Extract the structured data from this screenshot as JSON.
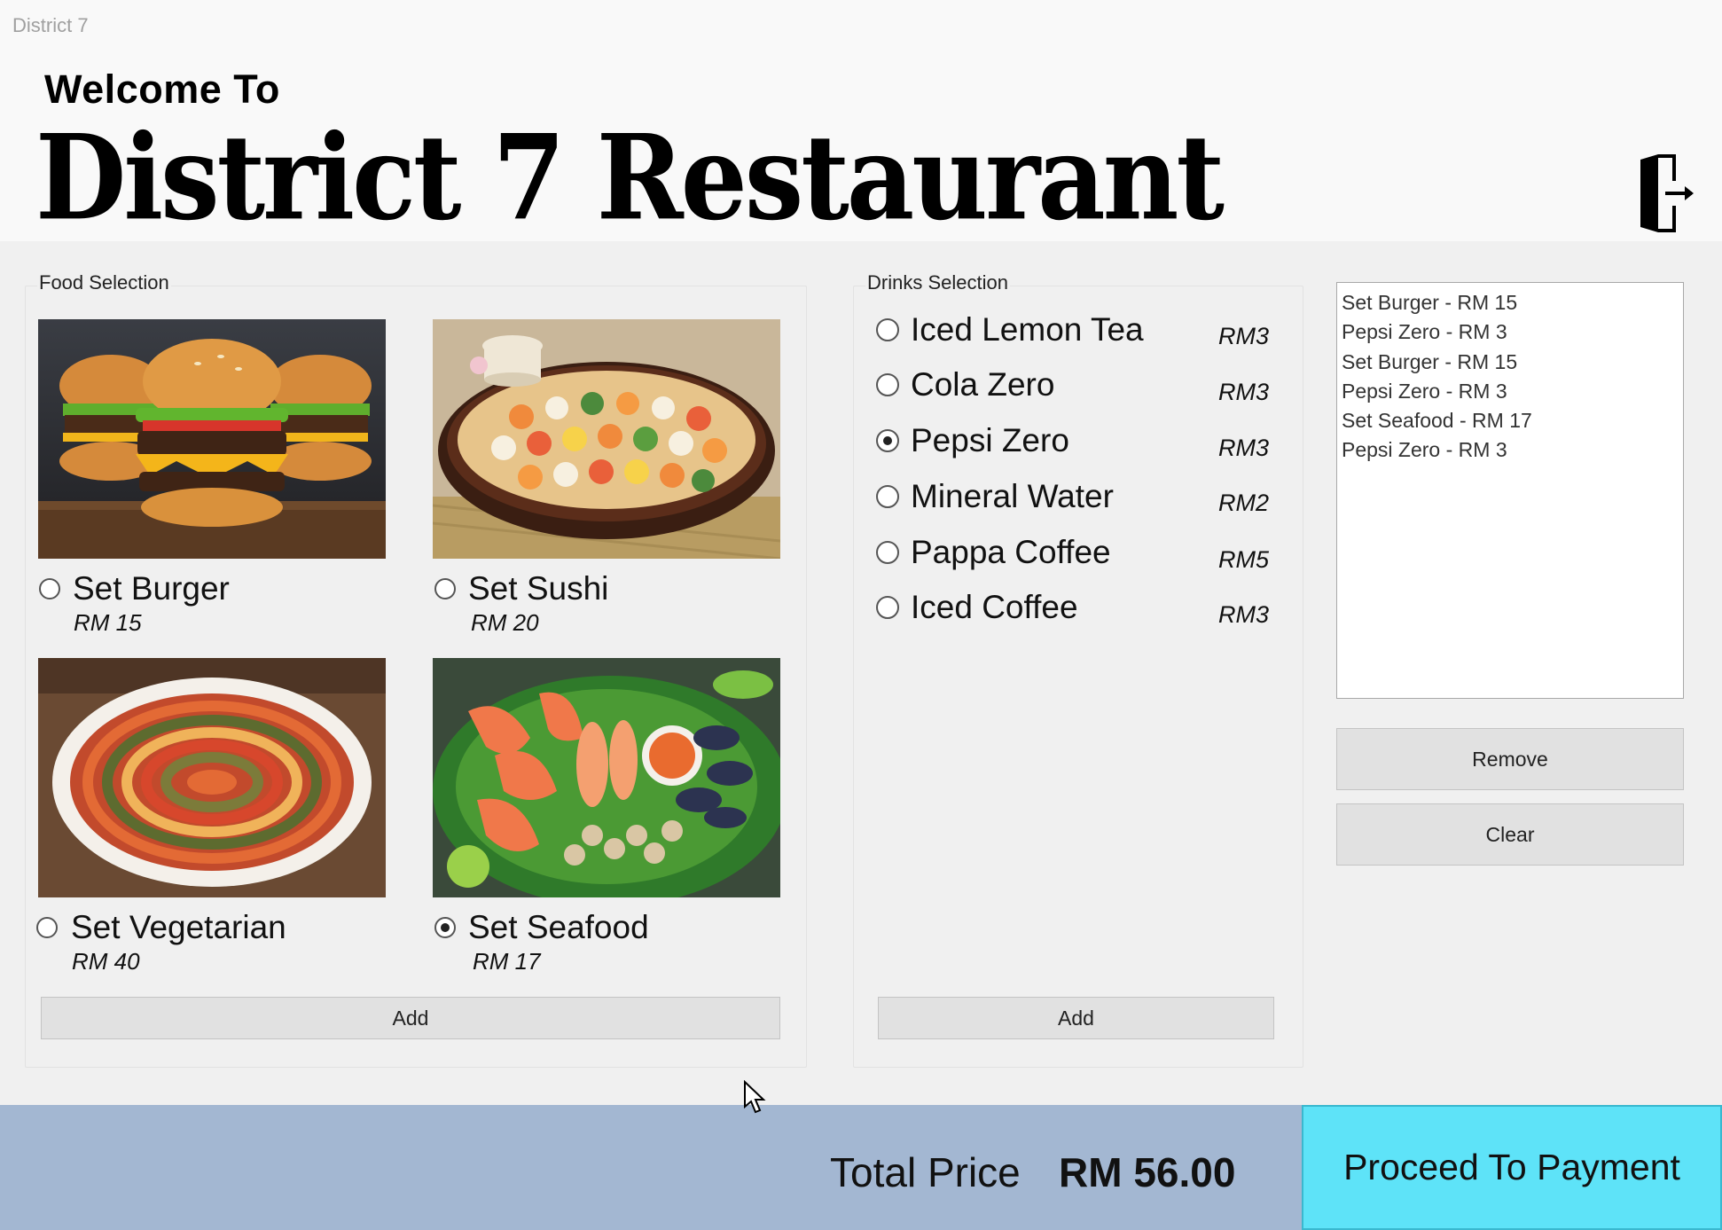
{
  "window": {
    "title": "District 7"
  },
  "header": {
    "welcome": "Welcome To",
    "name": "District 7 Restaurant",
    "exit_icon": "exit-door-icon"
  },
  "food": {
    "group_label": "Food Selection",
    "items": [
      {
        "name": "Set Burger",
        "price": "RM 15",
        "checked": false,
        "image": "burger-image"
      },
      {
        "name": "Set Sushi",
        "price": "RM 20",
        "checked": false,
        "image": "sushi-image"
      },
      {
        "name": "Set Vegetarian",
        "price": "RM 40",
        "checked": false,
        "image": "vegetarian-image"
      },
      {
        "name": "Set Seafood",
        "price": "RM 17",
        "checked": true,
        "image": "seafood-image"
      }
    ],
    "add_label": "Add"
  },
  "drinks": {
    "group_label": "Drinks Selection",
    "items": [
      {
        "name": "Iced Lemon Tea",
        "price": "RM3",
        "checked": false
      },
      {
        "name": "Cola Zero",
        "price": "RM3",
        "checked": false
      },
      {
        "name": "Pepsi Zero",
        "price": "RM3",
        "checked": true
      },
      {
        "name": "Mineral Water",
        "price": "RM2",
        "checked": false
      },
      {
        "name": "Pappa Coffee",
        "price": "RM5",
        "checked": false
      },
      {
        "name": "Iced Coffee",
        "price": "RM3",
        "checked": false
      }
    ],
    "add_label": "Add"
  },
  "order": {
    "items": [
      "Set Burger - RM 15",
      "Pepsi Zero - RM 3",
      "Set Burger - RM 15",
      "Pepsi Zero - RM 3",
      "Set Seafood - RM 17",
      "Pepsi Zero - RM 3"
    ],
    "remove_label": "Remove",
    "clear_label": "Clear"
  },
  "footer": {
    "total_label": "Total Price",
    "total_value": "RM 56.00",
    "pay_label": "Proceed To Payment"
  },
  "colors": {
    "footer_bg": "#a3b7d2",
    "pay_button_bg": "#5ee3f8",
    "window_bg": "#f0f0f0"
  }
}
